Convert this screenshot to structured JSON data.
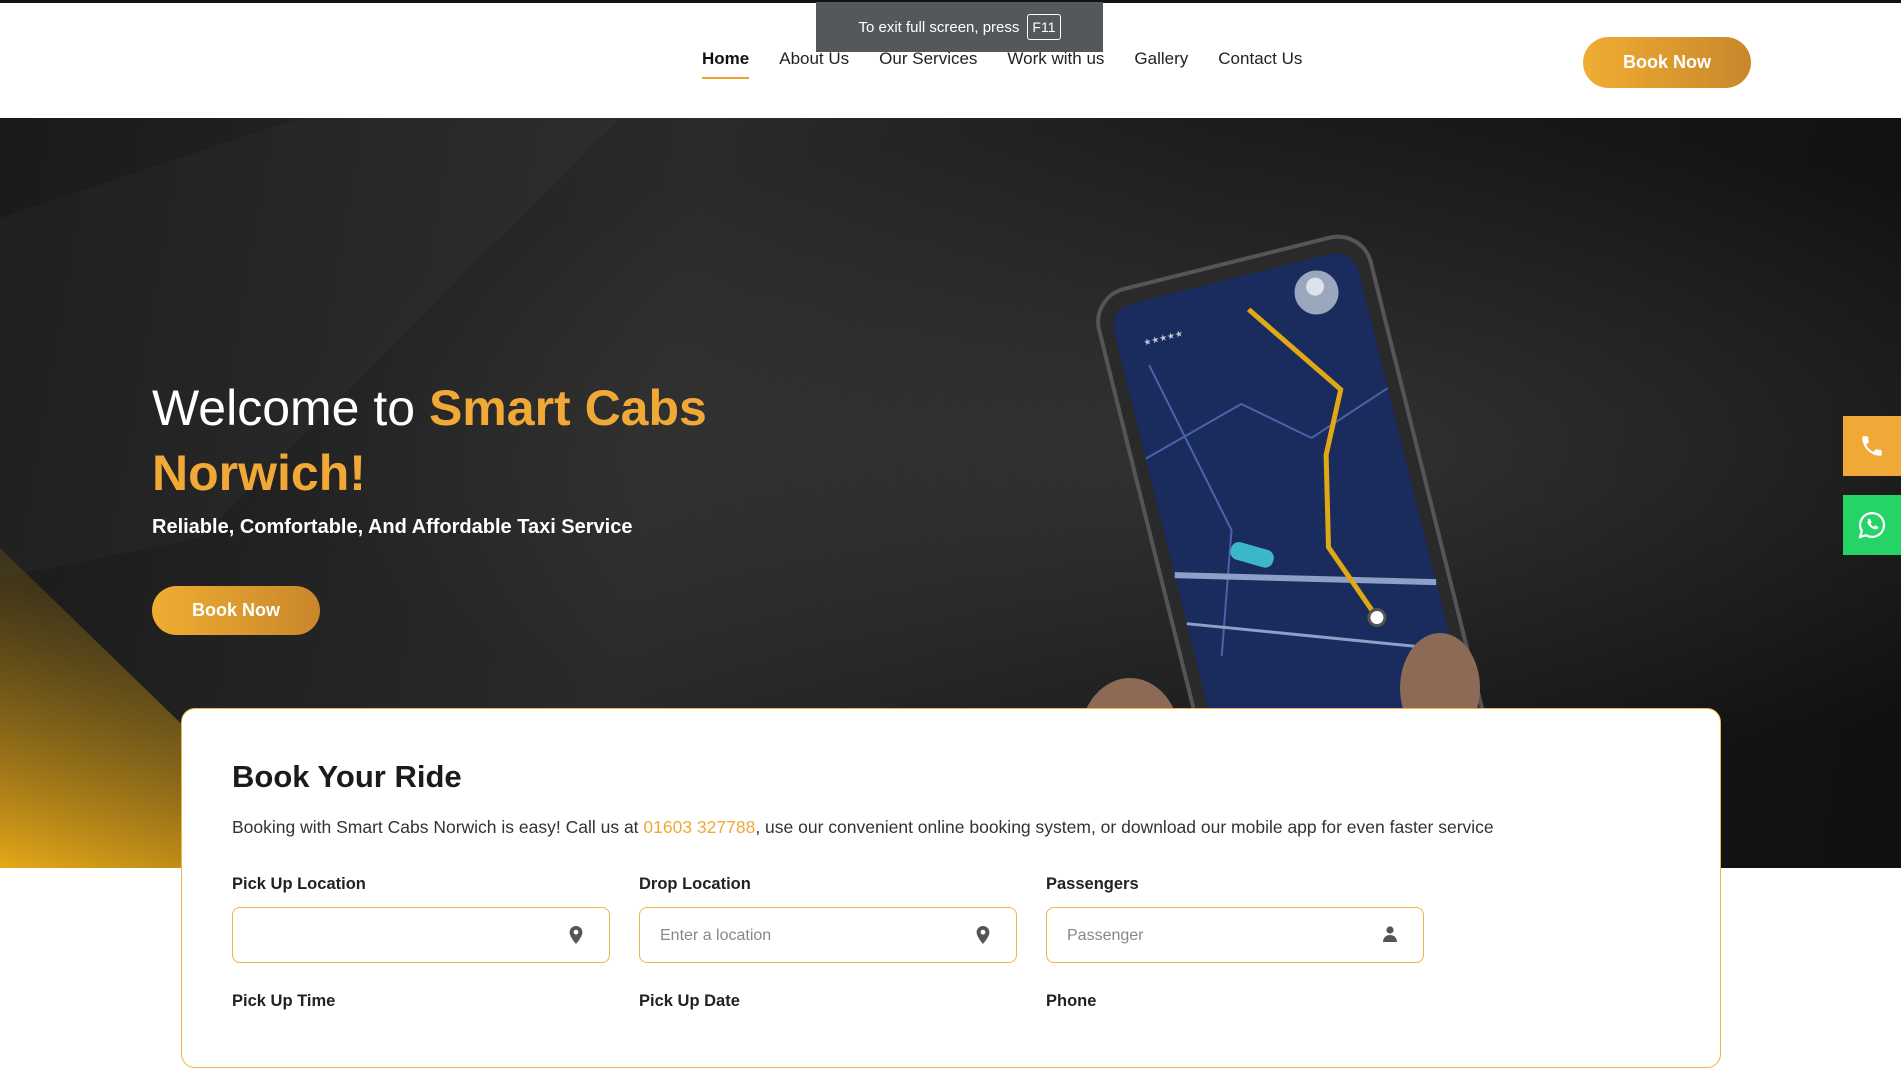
{
  "browser": {
    "fullscreen_notice": "To exit full screen, press",
    "fullscreen_key": "F11"
  },
  "nav": {
    "items": [
      {
        "label": "Home",
        "active": true
      },
      {
        "label": "About Us",
        "active": false
      },
      {
        "label": "Our Services",
        "active": false
      },
      {
        "label": "Work with us",
        "active": false
      },
      {
        "label": "Gallery",
        "active": false
      },
      {
        "label": "Contact Us",
        "active": false
      }
    ],
    "cta_label": "Book Now"
  },
  "hero": {
    "title_prefix": "Welcome to ",
    "title_highlight": "Smart Cabs Norwich!",
    "tagline": "Reliable, Comfortable, And Affordable Taxi Service",
    "cta_label": "Book Now"
  },
  "side_buttons": {
    "call_icon": "phone-icon",
    "whatsapp_icon": "whatsapp-icon"
  },
  "booking": {
    "title": "Book Your Ride",
    "intro_before": "Booking with Smart Cabs Norwich is easy! Call us at ",
    "phone": "01603 327788",
    "intro_after": ", use our convenient online booking system, or download our mobile app for even faster service",
    "fields": [
      {
        "label": "Pick Up Location",
        "value": "",
        "placeholder": "",
        "icon": "map-pin-icon"
      },
      {
        "label": "Drop Location",
        "value": "",
        "placeholder": "Enter a location",
        "icon": "map-pin-icon"
      },
      {
        "label": "Passengers",
        "value": "",
        "placeholder": "Passenger",
        "icon": "user-icon"
      }
    ],
    "second_row_labels": [
      "Pick Up Time",
      "Pick Up Date",
      "Phone"
    ]
  },
  "colors": {
    "accent": "#f0a937",
    "accent_dark": "#c9872b",
    "whatsapp": "#25d366",
    "hero_bg": "#1c1c1c"
  }
}
